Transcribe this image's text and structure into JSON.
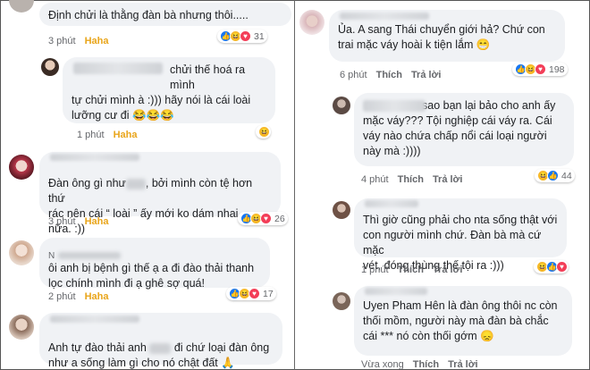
{
  "left": [
    {
      "text": "Định chửi là thằng đàn bà nhưng thôi.....",
      "time": "3 phút",
      "reaction_label": "Haha",
      "react_count": "31",
      "react_icons": [
        "like-icon",
        "haha-icon",
        "love-icon"
      ]
    },
    {
      "text_lines": [
        "chửi thế hoá ra mình",
        "tự chửi mình à :))) hãy nói là cái loài",
        "lưỡng cư đi 😂😂😂"
      ],
      "time": "1 phút",
      "reaction_label": "Haha",
      "react_icons": [
        "haha-icon"
      ]
    },
    {
      "text_lines": [
        "Đàn ông gì như",
        ", bởi mình còn tệ hơn thứ",
        "rác nên cái “ loài ” ấy mới ko dám nhai",
        "nữa. :))"
      ],
      "time": "3 phút",
      "reaction_label": "Haha",
      "react_count": "26",
      "react_icons": [
        "like-icon",
        "haha-icon",
        "love-icon"
      ]
    },
    {
      "name_initial": "N",
      "text_lines": [
        "ôi anh bị bệnh gì thế ạ a đi đào thải thanh",
        "lọc chính mình đi ạ ghê sợ quá!"
      ],
      "time": "2 phút",
      "reaction_label": "Haha",
      "react_count": "17",
      "react_icons": [
        "like-icon",
        "haha-icon",
        "love-icon"
      ]
    },
    {
      "text_lines": [
        "Anh tự đào thải anh",
        "đi chứ loại đàn ông",
        "như a sống làm gì cho nó chật đất 🙏"
      ]
    }
  ],
  "right": [
    {
      "text_lines": [
        "Ủa. A sang Thái chuyển giới hả? Chứ con",
        "trai mặc váy hoài k tiện lắm 😁"
      ],
      "time": "6 phút",
      "like": "Thích",
      "reply": "Trả lời",
      "react_count": "198",
      "react_icons": [
        "like-icon",
        "haha-icon",
        "love-icon"
      ]
    },
    {
      "text_lines": [
        "sao bạn lại bảo cho anh ấy",
        "mặc váy??? Tội nghiệp cái váy ra. Cái",
        "váy nào chứa chấp nổi cái loại người",
        "này mà :))))"
      ],
      "time": "4 phút",
      "like": "Thích",
      "reply": "Trả lời",
      "react_count": "44",
      "react_icons": [
        "haha-icon",
        "like-icon"
      ]
    },
    {
      "text_lines": [
        "Thì giờ cũng phải cho nta sống thật với",
        "con người mình chứ. Đàn bà mà cứ mặc",
        "vét, đóng thùng thế tội ra :)))"
      ],
      "time": "1 phút",
      "like": "Thích",
      "reply": "Trả lời",
      "react_icons": [
        "haha-icon",
        "like-icon",
        "love-icon"
      ]
    },
    {
      "text_lines": [
        "Uyen Pham Hên là đàn ông thôi nc còn",
        "thối mồm, người này mà đàn bà chắc",
        "cái *** nó còn thối gớm 😞"
      ],
      "time": "Vừa xong",
      "like": "Thích",
      "reply": "Trả lời"
    }
  ],
  "colors": {
    "bubble": "#f0f2f5",
    "haha": "#e9a51a",
    "like": "#1877f2",
    "love": "#f33e58"
  }
}
